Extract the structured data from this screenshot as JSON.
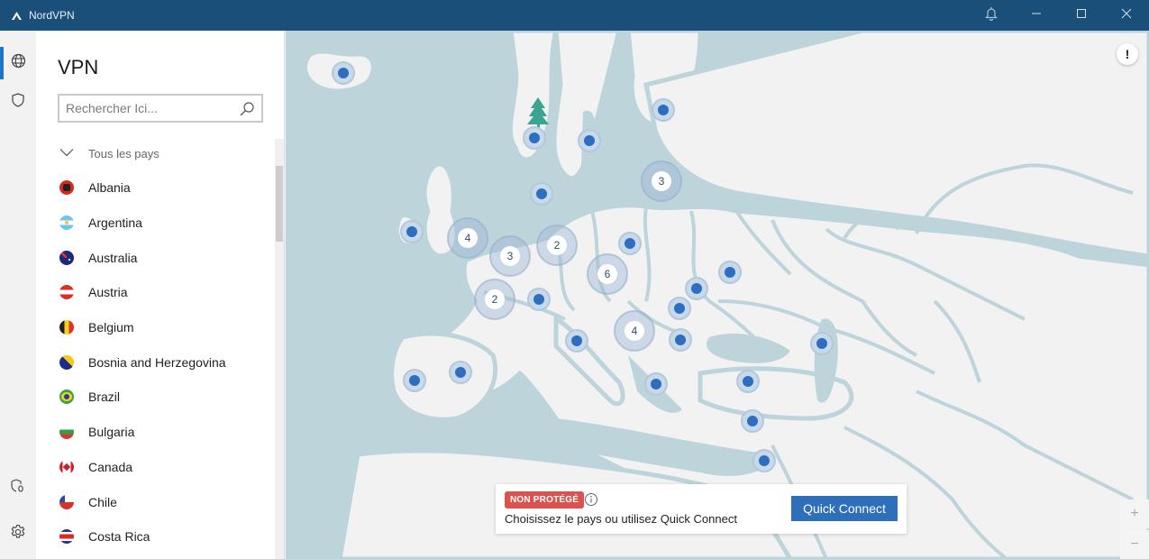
{
  "app": {
    "title": "NordVPN",
    "controls": [
      {
        "name": "notifications",
        "icon": "bell-icon"
      },
      {
        "name": "minimize",
        "icon": "minimize-icon"
      },
      {
        "name": "maximize",
        "icon": "maximize-icon"
      },
      {
        "name": "close",
        "icon": "close-icon"
      }
    ]
  },
  "rail": {
    "items": [
      {
        "name": "vpn",
        "icon": "globe-icon",
        "active": true
      },
      {
        "name": "threat-protection",
        "icon": "shield-icon",
        "active": false
      },
      {
        "name": "meshnet-status",
        "icon": "shield-zero-icon",
        "badge": "0"
      },
      {
        "name": "settings",
        "icon": "gear-icon"
      }
    ]
  },
  "panel": {
    "title": "VPN",
    "search": {
      "placeholder": "Rechercher Ici...",
      "value": ""
    },
    "group_label": "Tous les pays",
    "countries": [
      {
        "name": "Albania",
        "flag": "al"
      },
      {
        "name": "Argentina",
        "flag": "ar"
      },
      {
        "name": "Australia",
        "flag": "au"
      },
      {
        "name": "Austria",
        "flag": "at"
      },
      {
        "name": "Belgium",
        "flag": "be"
      },
      {
        "name": "Bosnia and Herzegovina",
        "flag": "ba"
      },
      {
        "name": "Brazil",
        "flag": "br"
      },
      {
        "name": "Bulgaria",
        "flag": "bg"
      },
      {
        "name": "Canada",
        "flag": "ca"
      },
      {
        "name": "Chile",
        "flag": "cl"
      },
      {
        "name": "Costa Rica",
        "flag": "cr"
      }
    ]
  },
  "map": {
    "alert_label": "!",
    "zoom_in": "+",
    "zoom_out": "−",
    "clusters": [
      {
        "label": "4"
      },
      {
        "label": "3"
      },
      {
        "label": "2"
      },
      {
        "label": "2"
      },
      {
        "label": "6"
      },
      {
        "label": "4"
      },
      {
        "label": "3"
      }
    ]
  },
  "status": {
    "badge": "NON PROTÉGÉ",
    "message": "Choisissez le pays ou utilisez Quick Connect",
    "quick_connect": "Quick Connect"
  },
  "colors": {
    "titlebar": "#1a4f7a",
    "accent": "#2f6fba",
    "danger": "#d9534f",
    "sea": "#bcd4da",
    "land": "#f2f2f2",
    "pin": "#2d6ec0"
  }
}
